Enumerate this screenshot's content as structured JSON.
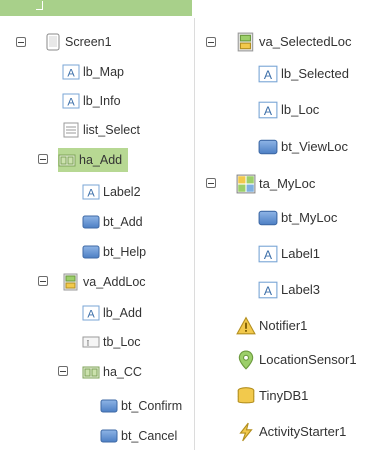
{
  "tree": {
    "left": [
      {
        "id": "screen1",
        "label": "Screen1",
        "icon": "screen-icon"
      },
      {
        "id": "lb_map",
        "label": "lb_Map",
        "icon": "label-icon"
      },
      {
        "id": "lb_info",
        "label": "lb_Info",
        "icon": "label-icon"
      },
      {
        "id": "list_select",
        "label": "list_Select",
        "icon": "listpicker-icon"
      },
      {
        "id": "ha_add",
        "label": "ha_Add",
        "icon": "horizontal-arrangement-icon",
        "selected": true
      },
      {
        "id": "label2",
        "label": "Label2",
        "icon": "label-icon"
      },
      {
        "id": "bt_add",
        "label": "bt_Add",
        "icon": "button-icon"
      },
      {
        "id": "bt_help",
        "label": "bt_Help",
        "icon": "button-icon"
      },
      {
        "id": "va_addloc",
        "label": "va_AddLoc",
        "icon": "vertical-arrangement-icon"
      },
      {
        "id": "lb_add",
        "label": "lb_Add",
        "icon": "label-icon"
      },
      {
        "id": "tb_loc",
        "label": "tb_Loc",
        "icon": "textbox-icon"
      },
      {
        "id": "ha_cc",
        "label": "ha_CC",
        "icon": "horizontal-arrangement-icon"
      },
      {
        "id": "bt_confirm",
        "label": "bt_Confirm",
        "icon": "button-icon"
      },
      {
        "id": "bt_cancel",
        "label": "bt_Cancel",
        "icon": "button-icon"
      }
    ],
    "right": [
      {
        "id": "va_selectedloc",
        "label": "va_SelectedLoc",
        "icon": "vertical-arrangement-icon"
      },
      {
        "id": "lb_selected",
        "label": "lb_Selected",
        "icon": "label-icon"
      },
      {
        "id": "lb_loc",
        "label": "lb_Loc",
        "icon": "label-icon"
      },
      {
        "id": "bt_viewloc",
        "label": "bt_ViewLoc",
        "icon": "button-icon"
      },
      {
        "id": "ta_myloc",
        "label": "ta_MyLoc",
        "icon": "table-arrangement-icon"
      },
      {
        "id": "bt_myloc",
        "label": "bt_MyLoc",
        "icon": "button-icon"
      },
      {
        "id": "label1",
        "label": "Label1",
        "icon": "label-icon"
      },
      {
        "id": "label3",
        "label": "Label3",
        "icon": "label-icon"
      },
      {
        "id": "notifier1",
        "label": "Notifier1",
        "icon": "notifier-icon"
      },
      {
        "id": "locationsensor1",
        "label": "LocationSensor1",
        "icon": "location-sensor-icon"
      },
      {
        "id": "tinydb1",
        "label": "TinyDB1",
        "icon": "tinydb-icon"
      },
      {
        "id": "activitystarter1",
        "label": "ActivityStarter1",
        "icon": "activity-starter-icon"
      }
    ]
  },
  "colors": {
    "selection": "#b7d893",
    "header": "#a8d08a",
    "text": "#333333"
  }
}
